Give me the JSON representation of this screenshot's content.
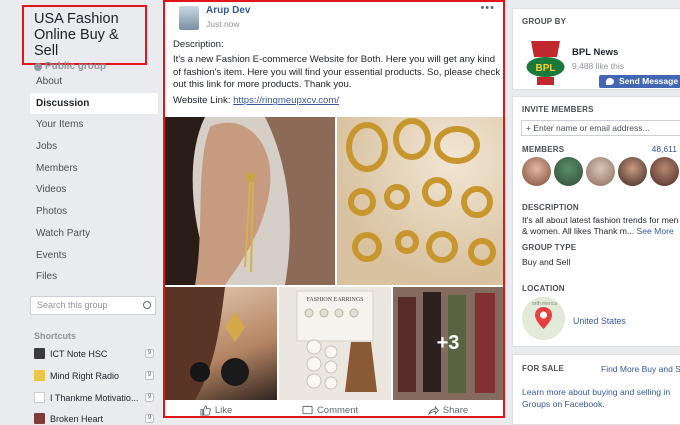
{
  "group": {
    "title": "USA Fashion Online Buy & Sell",
    "type": "Public group"
  },
  "nav": [
    {
      "label": "About"
    },
    {
      "label": "Discussion",
      "active": true
    },
    {
      "label": "Your Items"
    },
    {
      "label": "Jobs"
    },
    {
      "label": "Members"
    },
    {
      "label": "Videos"
    },
    {
      "label": "Photos"
    },
    {
      "label": "Watch Party"
    },
    {
      "label": "Events"
    },
    {
      "label": "Files"
    }
  ],
  "search": {
    "placeholder": "Search this group"
  },
  "shortcuts": {
    "heading": "Shortcuts",
    "items": [
      {
        "label": "ICT Note HSC",
        "badge": "9"
      },
      {
        "label": "Mind Right Radio",
        "badge": "9"
      },
      {
        "label": "I Thankme Motivatio...",
        "badge": "9"
      },
      {
        "label": "Broken Heart",
        "badge": "9"
      }
    ]
  },
  "post": {
    "author": "Arup Dev",
    "time": "Just now",
    "more_icon": "•••",
    "text_heading": "Description:",
    "text_body": "It's a new Fashion E-commerce Website for Both. Here you will get any kind of fashion's item. Here you will find your essential products. So, please check out this link for more products. Thank you.",
    "link_label": "Website Link:",
    "link_url": "https://ringmeupxcv.com/",
    "more_photos": "+3",
    "earring_card_text": "FASHION EARRINGS",
    "actions": {
      "like": "Like",
      "comment": "Comment",
      "share": "Share"
    }
  },
  "sidebar": {
    "group_by_label": "GROUP BY",
    "page_name": "BPL News",
    "page_likes": "9,488 like this",
    "send_message": "Send Message",
    "invite_label": "INVITE MEMBERS",
    "invite_placeholder": "+ Enter name or email address...",
    "members_label": "MEMBERS",
    "members_count": "48,611",
    "description_label": "DESCRIPTION",
    "description_text": "It's all about latest fashion trends for men & women. All likes Thank m...",
    "see_more": "See More",
    "group_type_label": "GROUP TYPE",
    "group_type_value": "Buy and Sell",
    "location_label": "LOCATION",
    "location_value": "United States",
    "map_text": "orth merica",
    "for_sale_label": "FOR SALE",
    "for_sale_link": "Find More Buy and Se",
    "for_sale_text": "Learn more about buying and selling in Groups on Facebook."
  },
  "colors": {
    "highlight_border": "#e0161b",
    "link_blue": "#365899",
    "button_blue": "#4267b2",
    "page_bg": "#e9ebee"
  }
}
